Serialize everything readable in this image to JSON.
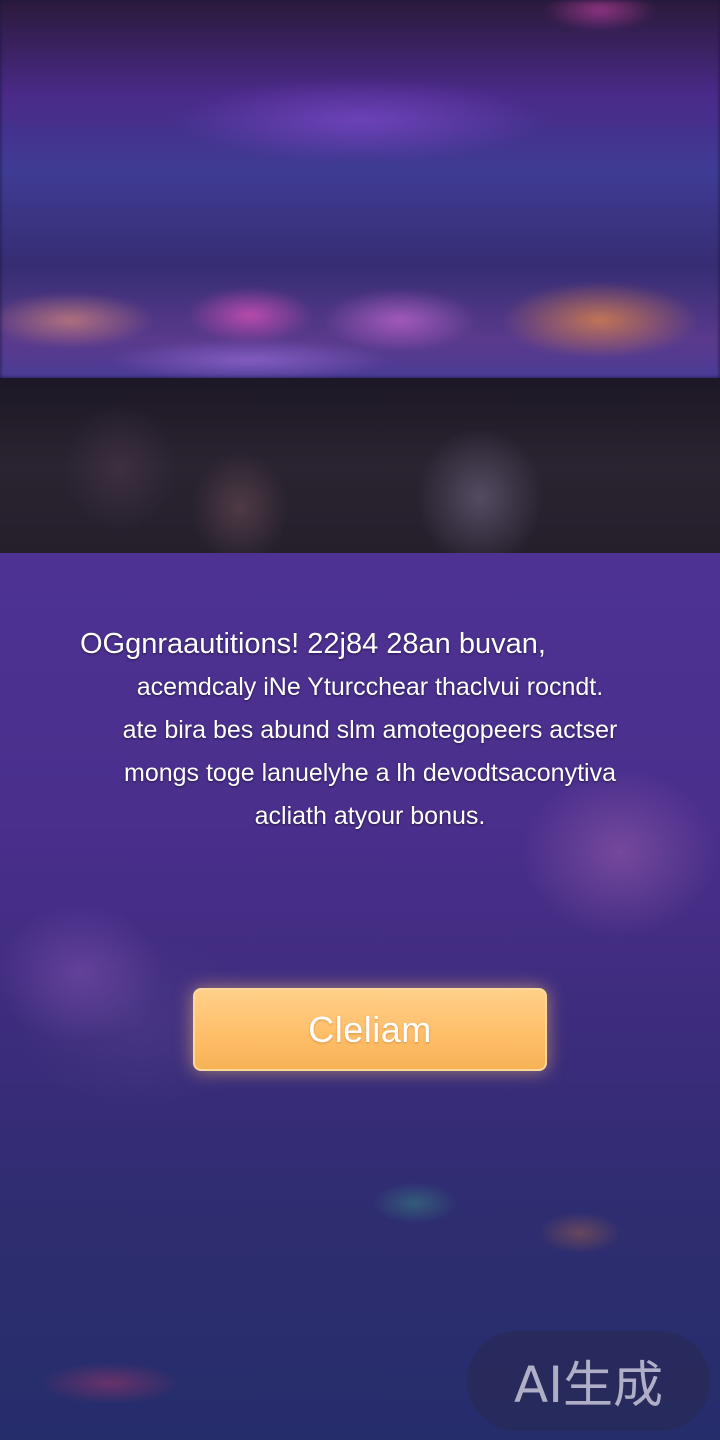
{
  "message": {
    "title": "OGgnraautitions! 22j84 28an buvan,",
    "lines": [
      "acemdcaly iNe Yturcchear thaclvui rocndt.",
      "ate bira bes abund slm amotegopeers actser",
      "mongs toge lanuelyhe a lh devodtsaconytiva",
      "acliath atyour bonus."
    ]
  },
  "claim_button": {
    "label": "Cleliam"
  },
  "watermark": {
    "label": "AI生成"
  },
  "colors": {
    "button_fill": "#ffbf6a",
    "backdrop": "#4a2f8c"
  }
}
